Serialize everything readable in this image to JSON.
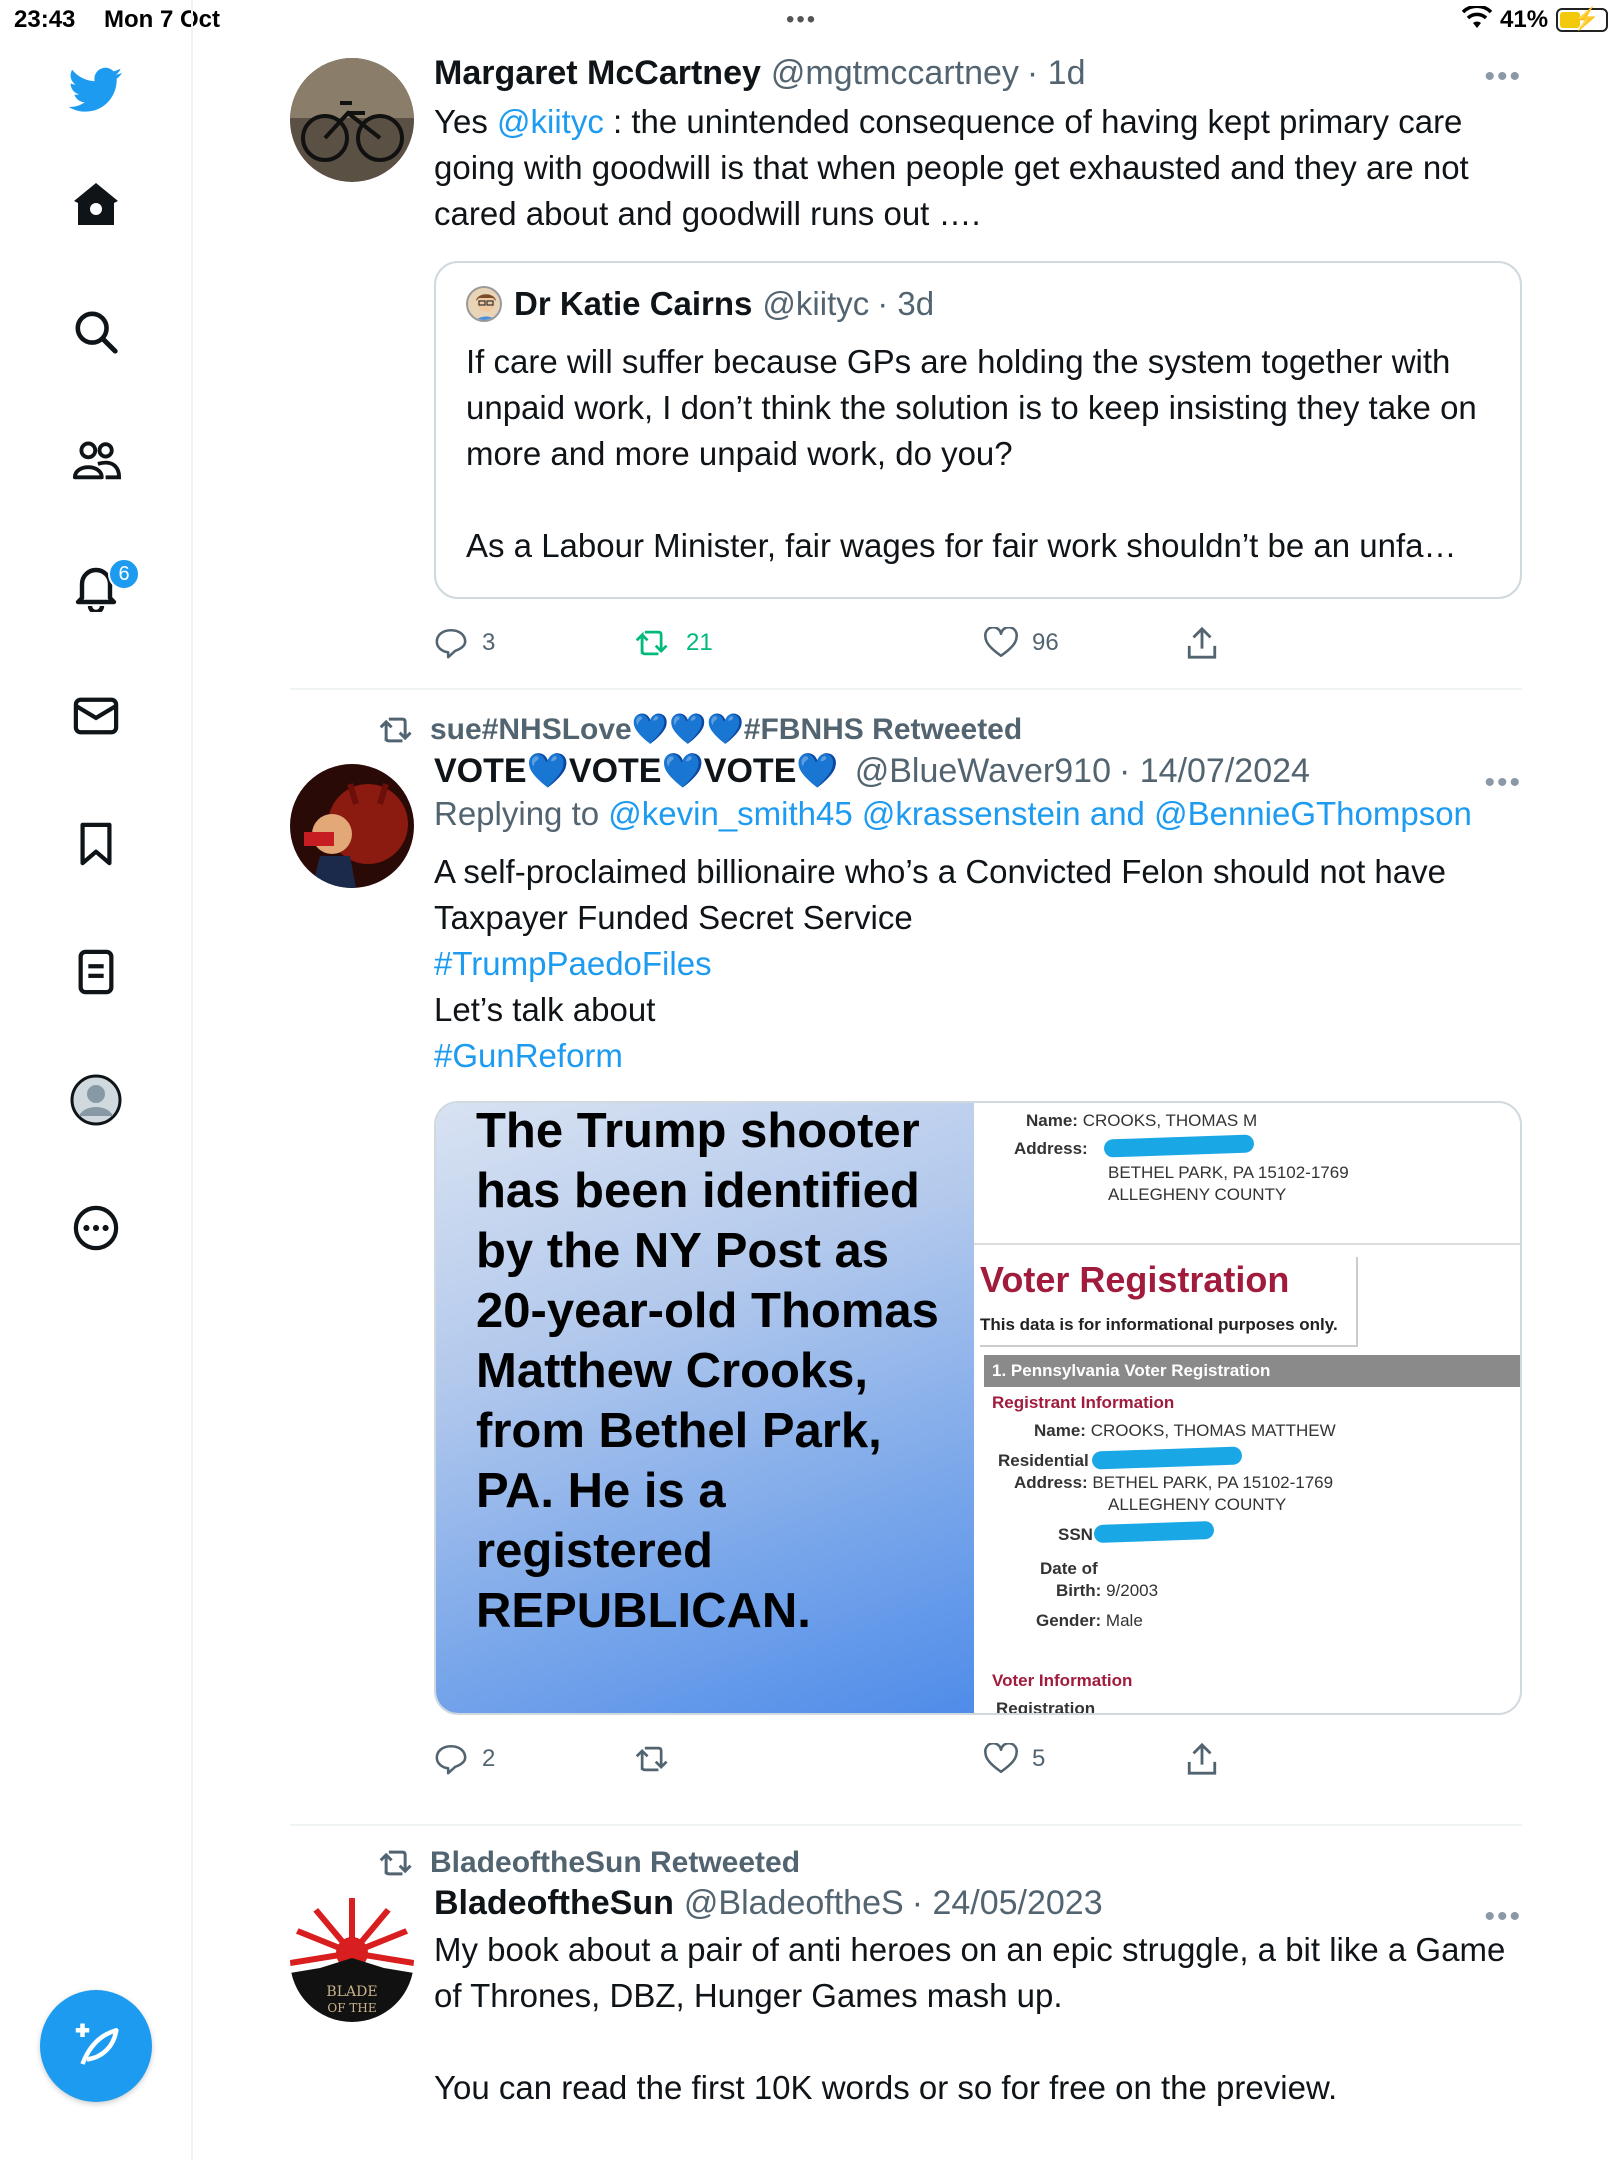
{
  "status_bar": {
    "time": "23:43",
    "date": "Mon 7 Oct",
    "battery": "41%"
  },
  "nav": {
    "notification_count": "6"
  },
  "tweets": [
    {
      "author_name": "Margaret McCartney",
      "author_handle": "@mgtmccartney",
      "time": "· 1d",
      "text_pre": "Yes ",
      "mention": "@kiityc",
      "text_post": " : the unintended consequence of having kept primary care going with goodwill is that when people get exhausted and they are not cared about and goodwill runs out ….",
      "quote": {
        "author_name": "Dr Katie Cairns",
        "author_handle": "@kiityc",
        "time": "· 3d",
        "text_1": "If care will suffer because GPs are holding the system together with unpaid work, I don’t think the solution is to keep insisting they take on more and more unpaid work, do you?",
        "text_2": "As a Labour Minister, fair wages for fair work shouldn’t be an unfa…"
      },
      "replies": "3",
      "retweets": "21",
      "likes": "96"
    },
    {
      "social_context": "sue#NHSLove💙💙💙#FBNHS Retweeted",
      "author_name": "VOTE💙VOTE💙VOTE💙",
      "author_handle": "@BlueWaver910",
      "time": "· 14/07/2024",
      "replying_to_label": "Replying to",
      "replying_to_1": "@kevin_smith45",
      "replying_to_2": "@krassenstein",
      "replying_to_and": "and",
      "replying_to_3": "@BennieGThompson",
      "line_1": "A self-proclaimed billionaire who’s a Convicted Felon should not have Taxpayer Funded Secret Service",
      "hashtag_1": "#TrumpPaedoFiles",
      "line_2": "Let’s talk about",
      "hashtag_2": "#GunReform",
      "image_text": "The Trump shooter has been identified by the NY Post as 20-year-old Thomas Matthew Crooks, from Bethel Park, PA. He is a registered REPUBLICAN.",
      "record": {
        "name_label": "Name:",
        "name_value": "CROOKS, THOMAS M",
        "address_label": "Address:",
        "address_line_2": "BETHEL PARK, PA 15102-1769",
        "address_line_3": "ALLEGHENY COUNTY",
        "title": "Voter Registration",
        "disclaimer": "This data is for informational purposes only.",
        "section": "1. Pennsylvania Voter Registration",
        "registrant_info": "Registrant Information",
        "name2_value": "CROOKS, THOMAS MATTHEW",
        "residential_label": "Residential",
        "address2_label": "Address:",
        "address2_line_2": "BETHEL PARK, PA 15102-1769",
        "address2_line_3": "ALLEGHENY COUNTY",
        "ssn_label": "SSN",
        "dob_label_1": "Date of",
        "dob_label_2": "Birth:",
        "dob_value": "9/2003",
        "gender_label": "Gender:",
        "gender_value": "Male",
        "voter_info": "Voter Information",
        "registration": "Registration"
      },
      "replies": "2",
      "retweets": "",
      "likes": "5"
    },
    {
      "social_context": "BladeoftheSun Retweeted",
      "author_name": "BladeoftheSun",
      "author_handle": "@BladeoftheS",
      "time": "· 24/05/2023",
      "text_1": "My book about a pair of anti heroes on an epic struggle, a bit like a Game of Thrones, DBZ, Hunger Games mash up.",
      "text_2": "You can read the first 10K words or so for free on the preview.",
      "avatar_text": "BLADE OF THE SUN"
    }
  ],
  "colors": {
    "accent": "#1d9bf0",
    "retweet_green": "#00ba7c",
    "muted": "#536471"
  }
}
